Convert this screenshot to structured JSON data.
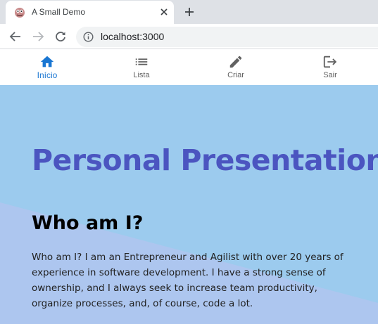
{
  "browser": {
    "tab_title": "A Small Demo",
    "url": "localhost:3000"
  },
  "icons": {
    "favicon": "app-favicon",
    "tab_close": "close-icon",
    "new_tab": "plus-icon",
    "back": "arrow-left-icon",
    "forward": "arrow-right-icon",
    "reload": "reload-icon",
    "site_info": "info-icon"
  },
  "appnav": {
    "items": [
      {
        "label": "Início",
        "icon": "home-icon",
        "active": true
      },
      {
        "label": "Lista",
        "icon": "list-icon",
        "active": false
      },
      {
        "label": "Criar",
        "icon": "pencil-icon",
        "active": false
      },
      {
        "label": "Sair",
        "icon": "logout-icon",
        "active": false
      }
    ]
  },
  "hero": {
    "title": "Personal Presentation",
    "subtitle": "Who am I?",
    "bio": "Who am I? I am an Entrepreneur and Agilist with over 20 years of experience in software development. I have a strong sense of ownership, and I always seek to increase team productivity, organize processes, and, of course, code a lot."
  },
  "colors": {
    "accent": "#1976d2",
    "hero_background": "#9ccbee",
    "hero_shape": "#adc6ef",
    "title_color": "#4b55c0"
  }
}
